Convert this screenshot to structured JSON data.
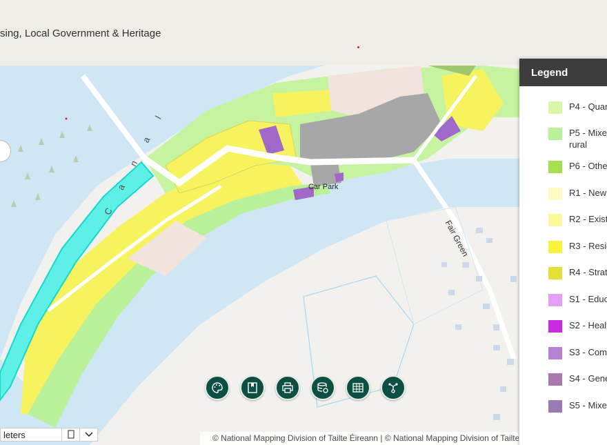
{
  "header": {
    "title": "sing, Local Government & Heritage"
  },
  "map": {
    "labels": {
      "canal": "C a n a l",
      "car_park": "Car Park",
      "fair_green": "Fair Green"
    },
    "colors": {
      "water": "#cfe6f5",
      "canal_zone": "#5ef0e6",
      "yellow": "#f7f35f",
      "light_green": "#c6f3a0",
      "grey": "#a7a7a7",
      "purple": "#a068c9",
      "forest": "#dfe9d8"
    }
  },
  "toolbar": {
    "tools": [
      {
        "icon": "palette-icon"
      },
      {
        "icon": "bookmark-icon"
      },
      {
        "icon": "print-icon"
      },
      {
        "icon": "layers-icon"
      },
      {
        "icon": "table-icon"
      },
      {
        "icon": "share-icon"
      }
    ]
  },
  "scale": {
    "label": "leters"
  },
  "attribution": "© National Mapping Division of Tailte Éireann | © National Mapping Division of Tailte Éireann",
  "legend": {
    "title": "Legend",
    "items": [
      {
        "label": "P4 - Quar",
        "color": "#d8f7a6"
      },
      {
        "label": "P5 - Mixe",
        "label2": "rural",
        "color": "#b9f09a"
      },
      {
        "label": "P6 - Othe",
        "color": "#a6e04e"
      },
      {
        "label": "R1 - New",
        "color": "#fdfbc4"
      },
      {
        "label": "R2 - Exist",
        "color": "#fbf79b"
      },
      {
        "label": "R3 - Resid",
        "color": "#faf33b"
      },
      {
        "label": "R4 - Strat",
        "color": "#e5e134"
      },
      {
        "label": "S1 - Educ",
        "color": "#e59ef5"
      },
      {
        "label": "S2 - Healt",
        "color": "#c92ce0"
      },
      {
        "label": "S3 - Com",
        "color": "#b483d6"
      },
      {
        "label": "S4 - Gene",
        "color": "#a878ae"
      },
      {
        "label": "S5 - Mixe",
        "color": "#9a7bb1"
      }
    ]
  }
}
